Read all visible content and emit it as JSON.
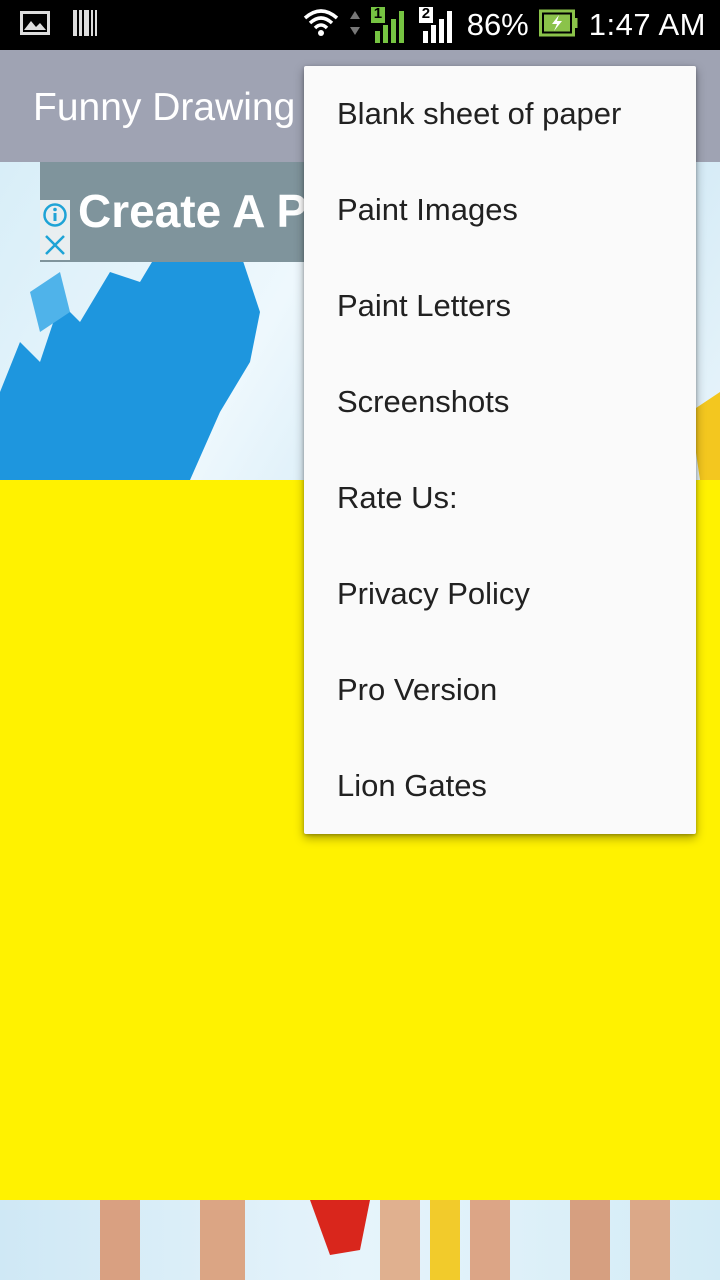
{
  "status_bar": {
    "battery_percent": "86%",
    "time": "1:47 AM",
    "sim1_label": "1",
    "sim2_label": "2",
    "icons": [
      "gallery-icon",
      "barcode-icon",
      "wifi-icon",
      "data-arrows-icon",
      "signal-sim1-icon",
      "signal-sim2-icon",
      "battery-charging-icon"
    ]
  },
  "app_bar": {
    "title": "Funny Drawing"
  },
  "ad": {
    "text": "Create A P",
    "icons": [
      "info-icon",
      "close-icon"
    ]
  },
  "menu": {
    "items": [
      {
        "label": "Blank sheet of paper"
      },
      {
        "label": "Paint Images"
      },
      {
        "label": "Paint Letters"
      },
      {
        "label": "Screenshots"
      },
      {
        "label": "Rate Us:"
      },
      {
        "label": "Privacy Policy"
      },
      {
        "label": "Pro Version"
      },
      {
        "label": "Lion Gates"
      }
    ]
  },
  "colors": {
    "status_bar": "#000000",
    "app_bar": "#9fa3b3",
    "menu_background": "#fafafa",
    "yellow_panel": "#fff200",
    "ad_background": "#7f949c",
    "battery_green": "#8bc34a",
    "ad_icon_blue": "#1fa3d6"
  }
}
